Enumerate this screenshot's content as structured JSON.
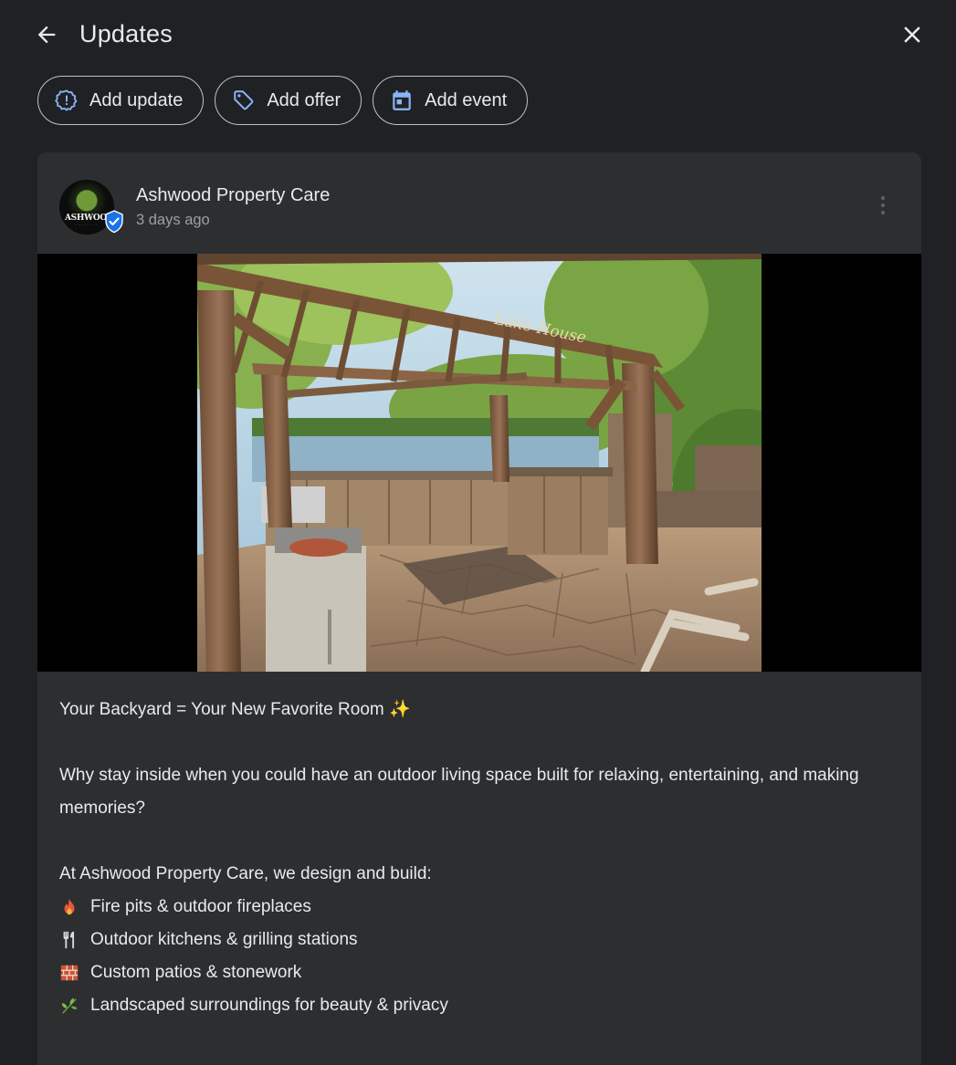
{
  "header": {
    "title": "Updates"
  },
  "actions": {
    "add_update": "Add update",
    "add_offer": "Add offer",
    "add_event": "Add event"
  },
  "post": {
    "business_name": "Ashwood Property Care",
    "time_ago": "3 days ago",
    "avatar_logo_text": "ASHWOOD",
    "photo_sign_text": "Lake House",
    "headline": "Your Backyard = Your New Favorite Room ✨",
    "paragraph": "Why stay inside when you could have an outdoor living space built for relaxing, entertaining, and making memories?",
    "intro": "At Ashwood Property Care, we design and build:",
    "list": [
      {
        "icon": "fire-emoji",
        "text": "Fire pits & outdoor fireplaces"
      },
      {
        "icon": "fork-knife-emoji",
        "text": "Outdoor kitchens & grilling stations"
      },
      {
        "icon": "brick-emoji",
        "text": "Custom patios & stonework"
      },
      {
        "icon": "herb-emoji",
        "text": "Landscaped surroundings for beauty & privacy"
      }
    ]
  },
  "colors": {
    "background": "#202124",
    "card": "#2d2e30",
    "text": "#e8eaed",
    "muted": "#9aa0a6",
    "accent": "#8ab4f8",
    "verified": "#1a73e8"
  }
}
